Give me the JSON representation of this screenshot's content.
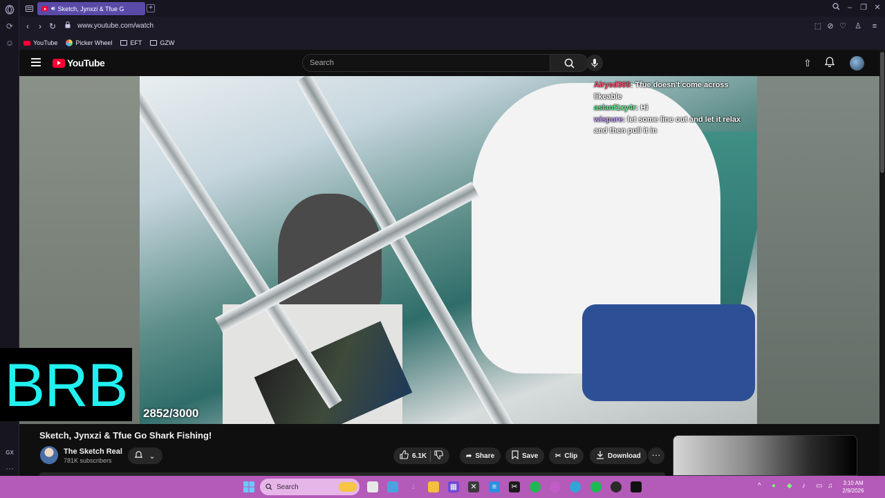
{
  "browser": {
    "tab_title": "Sketch, Jynxzi & Tfue G",
    "tab_audio_icon": "speaker-icon",
    "new_tab_label": "+",
    "url": "www.youtube.com/watch",
    "bookmarks": [
      {
        "label": "YouTube",
        "icon": "youtube-icon"
      },
      {
        "label": "Picker Wheel",
        "icon": "wheel-icon"
      },
      {
        "label": "EFT",
        "icon": "folder-icon"
      },
      {
        "label": "GZW",
        "icon": "folder-icon"
      }
    ],
    "rail": {
      "gx_label": "GX",
      "more_label": "···"
    }
  },
  "youtube": {
    "logo_text": "YouTube",
    "search_placeholder": "Search",
    "video": {
      "chat": [
        {
          "user": "Airyed305",
          "message": ": Tfue doesn't come across likeable",
          "color": "#ff4d6d"
        },
        {
          "user": "aslanf1xy4r",
          "message": ": Hi",
          "color": "#5cf08b"
        },
        {
          "user": "wispure",
          "message": ": let some line out and let it relax and then pull it in",
          "color": "#c8a2ff"
        }
      ],
      "counter": "2852/3000"
    },
    "overlay_brb": "BRB",
    "title": "Sketch, Jynxzi & Tfue Go Shark Fishing!",
    "channel": {
      "name": "The Sketch Real",
      "subscribers": "781K subscribers"
    },
    "actions": {
      "likes": "6.1K",
      "share": "Share",
      "save": "Save",
      "clip": "Clip",
      "download": "Download",
      "more": "···"
    }
  },
  "taskbar": {
    "search_placeholder": "Search",
    "time": "3:10 AM",
    "date": "2/9/2026"
  }
}
